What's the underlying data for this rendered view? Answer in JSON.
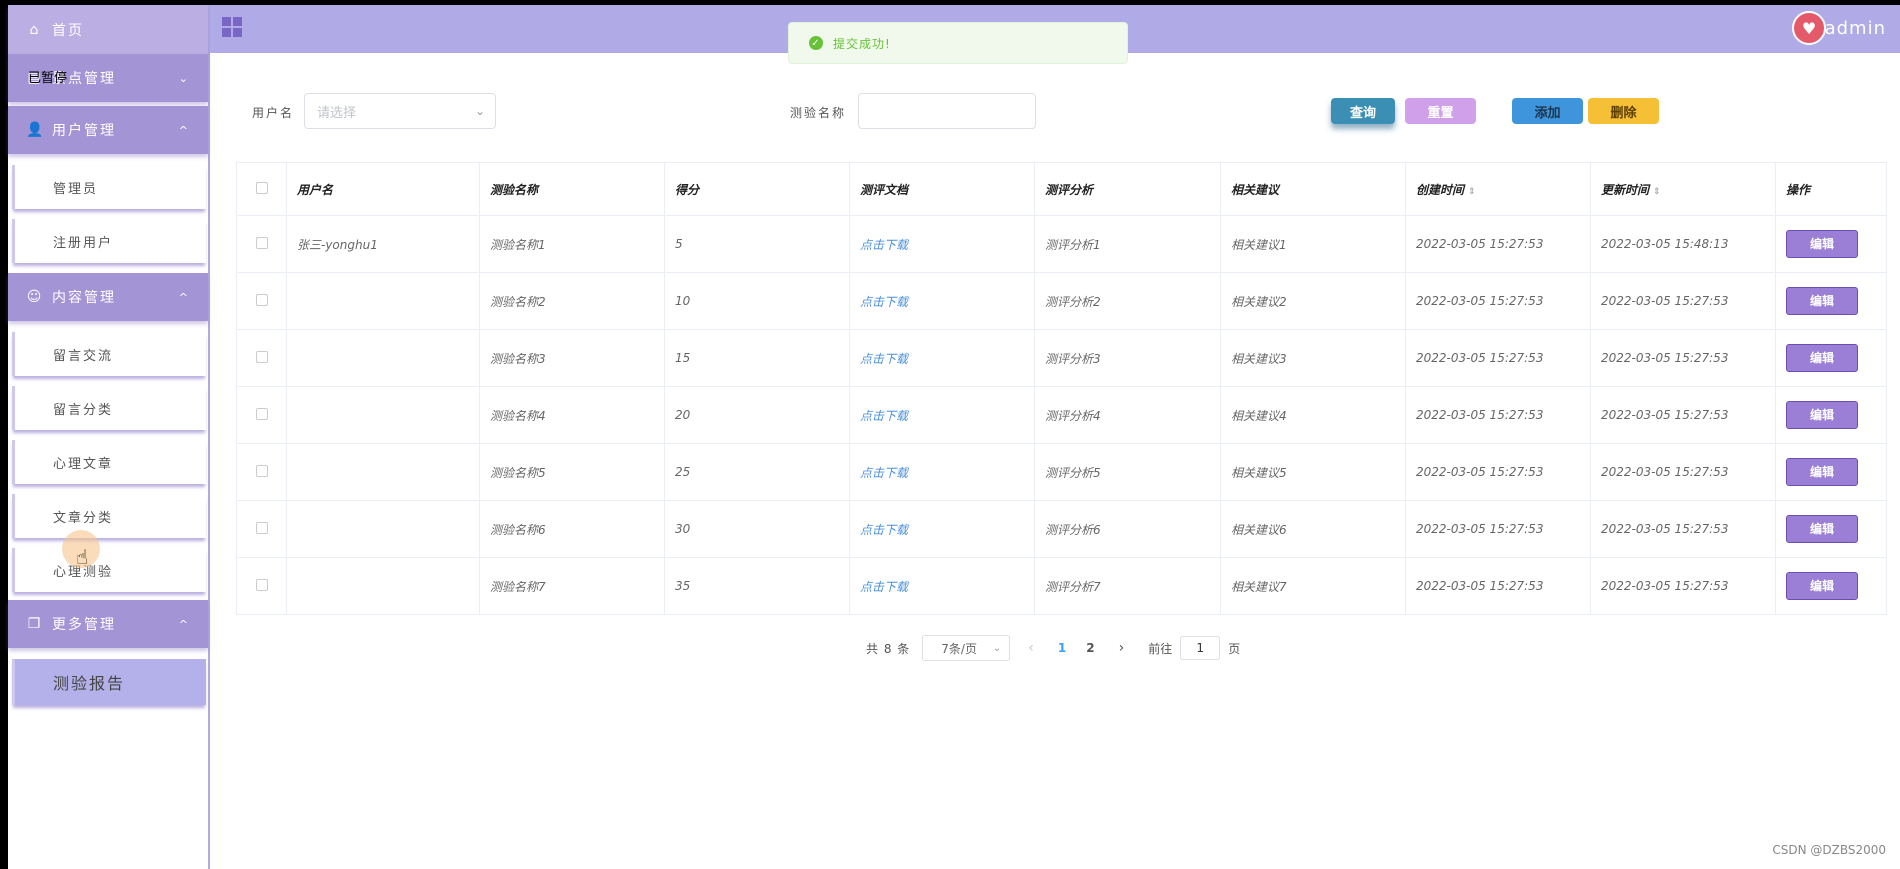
{
  "sidebar": {
    "home": "首页",
    "overlay_tip": "已暂停",
    "groups": [
      {
        "label": "景点管理",
        "caret": "⌄"
      },
      {
        "label": "用户管理",
        "caret": "^"
      },
      {
        "label": "内容管理",
        "caret": "^"
      },
      {
        "label": "更多管理",
        "caret": "^"
      }
    ],
    "items": [
      "管理员",
      "注册用户",
      "留言交流",
      "留言分类",
      "心理文章",
      "文章分类",
      "心理测验",
      "测验报告"
    ]
  },
  "header": {
    "username": "admin"
  },
  "toast": {
    "message": "提交成功!"
  },
  "filters": {
    "username_label": "用户名",
    "username_placeholder": "请选择",
    "test_name_label": "测验名称",
    "query": "查询",
    "reset": "重置",
    "add": "添加",
    "delete": "删除"
  },
  "table": {
    "headers": [
      "用户名",
      "测验名称",
      "得分",
      "测评文档",
      "测评分析",
      "相关建议",
      "创建时间",
      "更新时间",
      "操作"
    ],
    "rows": [
      [
        "张三-yonghu1",
        "测验名称1",
        "5",
        "点击下载",
        "测评分析1",
        "相关建议1",
        "2022-03-05 15:27:53",
        "2022-03-05 15:48:13",
        "编辑"
      ],
      [
        "",
        "测验名称2",
        "10",
        "点击下载",
        "测评分析2",
        "相关建议2",
        "2022-03-05 15:27:53",
        "2022-03-05 15:27:53",
        "编辑"
      ],
      [
        "",
        "测验名称3",
        "15",
        "点击下载",
        "测评分析3",
        "相关建议3",
        "2022-03-05 15:27:53",
        "2022-03-05 15:27:53",
        "编辑"
      ],
      [
        "",
        "测验名称4",
        "20",
        "点击下载",
        "测评分析4",
        "相关建议4",
        "2022-03-05 15:27:53",
        "2022-03-05 15:27:53",
        "编辑"
      ],
      [
        "",
        "测验名称5",
        "25",
        "点击下载",
        "测评分析5",
        "相关建议5",
        "2022-03-05 15:27:53",
        "2022-03-05 15:27:53",
        "编辑"
      ],
      [
        "",
        "测验名称6",
        "30",
        "点击下载",
        "测评分析6",
        "相关建议6",
        "2022-03-05 15:27:53",
        "2022-03-05 15:27:53",
        "编辑"
      ],
      [
        "",
        "测验名称7",
        "35",
        "点击下载",
        "测评分析7",
        "相关建议7",
        "2022-03-05 15:27:53",
        "2022-03-05 15:27:53",
        "编辑"
      ]
    ]
  },
  "pagination": {
    "total": "共 8 条",
    "page_size": "7条/页",
    "prev": "‹",
    "pages": [
      "1",
      "2"
    ],
    "next": "›",
    "goto_label": "前往",
    "goto_value": "1",
    "goto_suffix": "页"
  },
  "watermark": "CSDN @DZBS2000",
  "colors": {
    "sidebar_head": "#a394d6",
    "header": "#b0aae6",
    "active_item": "#b3b0ea",
    "edit_button": "#9b7fd6"
  }
}
